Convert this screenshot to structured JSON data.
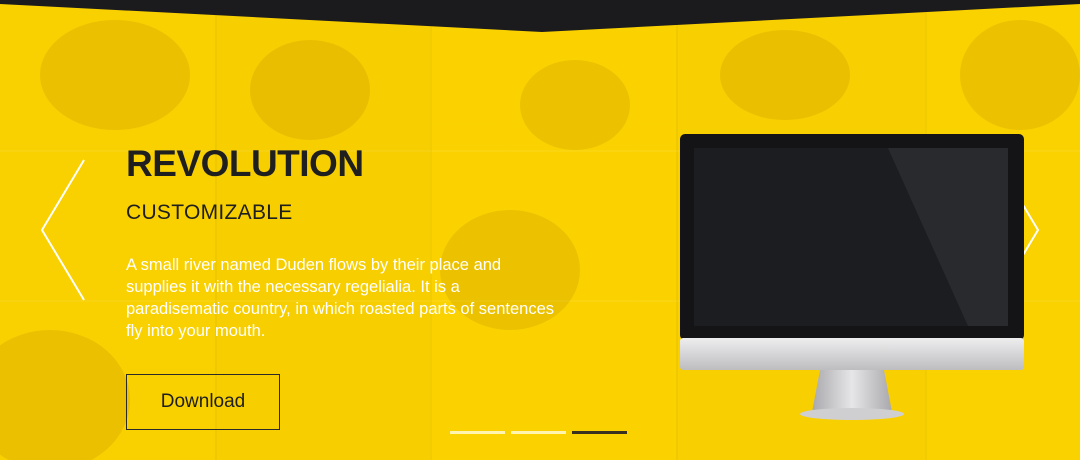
{
  "slide": {
    "title": "REVOLUTION",
    "subtitle": "CUSTOMIZABLE",
    "description": "A small river named Duden flows by their place and supplies it with the necessary regelialia. It is a paradisematic country, in which roasted parts of sentences fly into your mouth.",
    "button_label": "Download"
  },
  "navigation": {
    "prev_icon": "chevron-left-icon",
    "next_icon": "chevron-right-icon"
  },
  "indicators": [
    {
      "state": "inactive"
    },
    {
      "state": "inactive"
    },
    {
      "state": "active"
    }
  ],
  "colors": {
    "background_yellow": "#f3d100",
    "top_band": "#1b1b1d",
    "text_dark": "#1f1f1f",
    "text_light": "#ffffff",
    "indicator_inactive": "#fff4b0",
    "indicator_active": "#3a3120",
    "screen": "#1c1d20",
    "monitor_silver": "#d8d8da"
  }
}
